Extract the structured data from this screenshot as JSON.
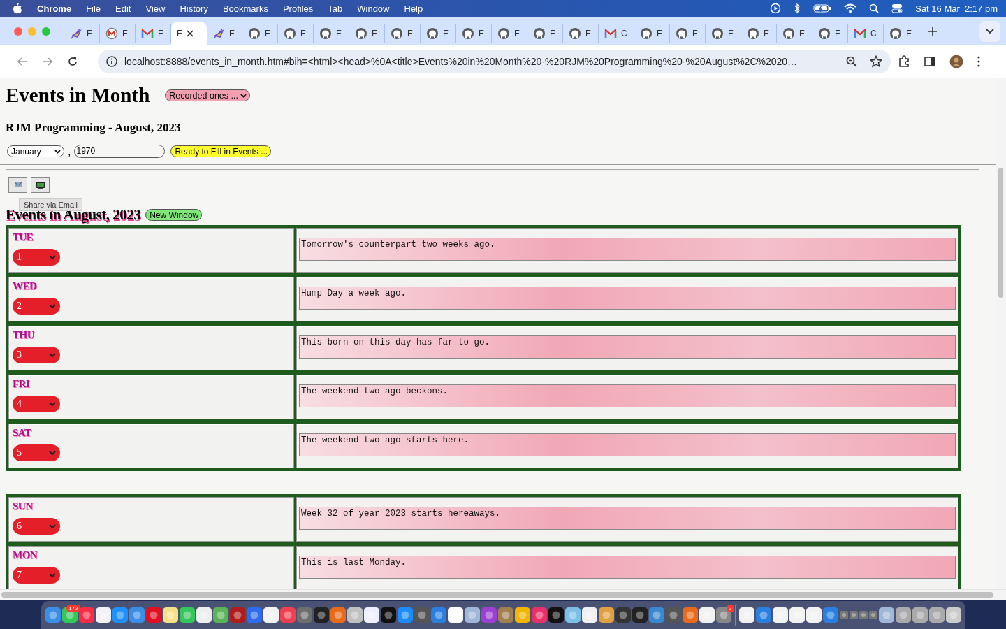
{
  "menu_bar": {
    "app": "Chrome",
    "items": [
      "File",
      "Edit",
      "View",
      "History",
      "Bookmarks",
      "Profiles",
      "Tab",
      "Window",
      "Help"
    ],
    "date": "Sat 16 Mar",
    "time": "2:17 pm"
  },
  "tabs": [
    {
      "kind": "quill",
      "label": "E",
      "selected": false
    },
    {
      "kind": "m-circle",
      "label": "E",
      "selected": false
    },
    {
      "kind": "mail",
      "label": "E",
      "selected": false
    },
    {
      "kind": "plain",
      "label": "E",
      "selected": true
    },
    {
      "kind": "quill",
      "label": "E",
      "selected": false
    },
    {
      "kind": "round-logo",
      "label": "E",
      "selected": false
    },
    {
      "kind": "round-logo",
      "label": "E",
      "selected": false
    },
    {
      "kind": "round-logo",
      "label": "E",
      "selected": false
    },
    {
      "kind": "round-logo",
      "label": "E",
      "selected": false
    },
    {
      "kind": "round-logo",
      "label": "E",
      "selected": false
    },
    {
      "kind": "round-logo",
      "label": "E",
      "selected": false
    },
    {
      "kind": "round-logo",
      "label": "E",
      "selected": false
    },
    {
      "kind": "round-logo",
      "label": "E",
      "selected": false
    },
    {
      "kind": "round-logo",
      "label": "E",
      "selected": false
    },
    {
      "kind": "round-logo",
      "label": "E",
      "selected": false
    },
    {
      "kind": "mail",
      "label": "C",
      "selected": false
    },
    {
      "kind": "round-logo",
      "label": "E",
      "selected": false
    },
    {
      "kind": "round-logo",
      "label": "E",
      "selected": false
    },
    {
      "kind": "round-logo",
      "label": "E",
      "selected": false
    },
    {
      "kind": "round-logo",
      "label": "E",
      "selected": false
    },
    {
      "kind": "round-logo",
      "label": "E",
      "selected": false
    },
    {
      "kind": "round-logo",
      "label": "E",
      "selected": false
    },
    {
      "kind": "mail",
      "label": "C",
      "selected": false
    },
    {
      "kind": "round-logo",
      "label": "E",
      "selected": false
    }
  ],
  "address_bar": {
    "url": "localhost:8888/events_in_month.htm#bih=<html><head>%0A<title>Events%20in%20Month%20-%20RJM%20Programming%20-%20August%2C%2020…"
  },
  "page": {
    "title": "Events in Month",
    "recorded_select": "Recorded ones ...",
    "subtitle": "RJM Programming - August, 2023",
    "month_select": "January",
    "separator": ",",
    "year_field": "1970",
    "fill_button": "Ready to Fill in Events ...",
    "tooltip": "Share via Email",
    "events_heading": "Events in August, 2023",
    "new_window_button": "New Window",
    "groups": [
      {
        "rows": [
          {
            "day": "TUE",
            "date": "1",
            "note": "Tomorrow's counterpart two weeks ago."
          },
          {
            "day": "WED",
            "date": "2",
            "note": "Hump Day a week ago."
          },
          {
            "day": "THU",
            "date": "3",
            "note": "This born on this day has far to go."
          },
          {
            "day": "FRI",
            "date": "4",
            "note": "The weekend two ago beckons."
          },
          {
            "day": "SAT",
            "date": "5",
            "note": "The weekend two ago starts here."
          }
        ]
      },
      {
        "rows": [
          {
            "day": "SUN",
            "date": "6",
            "note": "Week 32 of year 2023 starts hereaways."
          },
          {
            "day": "MON",
            "date": "7",
            "note": "This is last Monday."
          }
        ]
      }
    ]
  },
  "dock": {
    "badges": [
      "172",
      "2"
    ]
  }
}
